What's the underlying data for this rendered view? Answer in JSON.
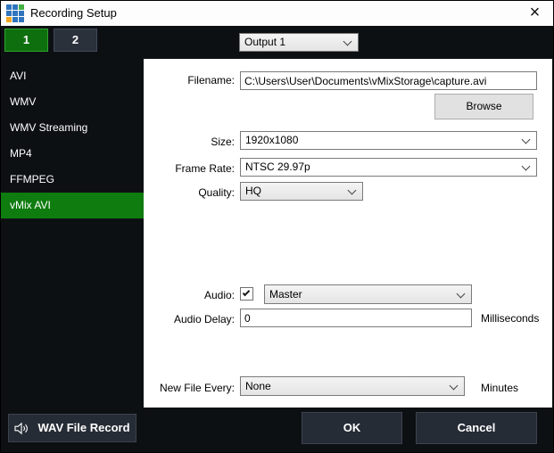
{
  "window": {
    "title": "Recording Setup",
    "close_glyph": "×"
  },
  "tabs": {
    "one": "1",
    "two": "2"
  },
  "output_selector": {
    "value": "Output 1"
  },
  "sidebar": {
    "items": [
      "AVI",
      "WMV",
      "WMV Streaming",
      "MP4",
      "FFMPEG",
      "vMix AVI"
    ],
    "selected": "vMix AVI"
  },
  "form": {
    "filename": {
      "label": "Filename:",
      "value": "C:\\Users\\User\\Documents\\vMixStorage\\capture.avi"
    },
    "browse_label": "Browse",
    "size": {
      "label": "Size:",
      "value": "1920x1080"
    },
    "frame_rate": {
      "label": "Frame Rate:",
      "value": "NTSC 29.97p"
    },
    "quality": {
      "label": "Quality:",
      "value": "HQ"
    },
    "audio": {
      "label": "Audio:",
      "checked": true,
      "value": "Master"
    },
    "audio_delay": {
      "label": "Audio Delay:",
      "value": "0",
      "unit": "Milliseconds"
    },
    "new_file_every": {
      "label": "New File Every:",
      "value": "None",
      "unit": "Minutes"
    }
  },
  "footer": {
    "wav_record_label": "WAV File Record",
    "ok_label": "OK",
    "cancel_label": "Cancel"
  },
  "colors": {
    "green_accent": "#0F7C0F",
    "tab_green_fill": "#0E6F0E",
    "tab_green_border": "#2FA32F",
    "dark_bg": "#0D1013",
    "dark_button": "#262C35",
    "dark_button_border": "#3C434E",
    "logo_blue": "#2E75BD",
    "logo_green": "#44B044",
    "logo_orange": "#F5A623"
  }
}
